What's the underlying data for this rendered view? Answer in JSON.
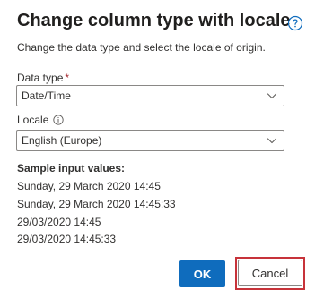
{
  "dialog": {
    "title": "Change column type with locale",
    "subtitle": "Change the data type and select the locale of origin.",
    "help_icon": "question-circle-icon"
  },
  "data_type": {
    "label": "Data type",
    "required_marker": "*",
    "value": "Date/Time",
    "icon": "chevron-down-icon"
  },
  "locale": {
    "label": "Locale",
    "info_icon": "info-circle-icon",
    "value": "English (Europe)",
    "icon": "chevron-down-icon"
  },
  "samples": {
    "heading": "Sample input values:",
    "values": [
      "Sunday, 29 March 2020 14:45",
      "Sunday, 29 March 2020 14:45:33",
      "29/03/2020 14:45",
      "29/03/2020 14:45:33"
    ]
  },
  "buttons": {
    "ok_label": "OK",
    "cancel_label": "Cancel"
  },
  "colors": {
    "primary": "#0f6cbd",
    "highlight": "#c7333a",
    "required": "#a4262c"
  }
}
